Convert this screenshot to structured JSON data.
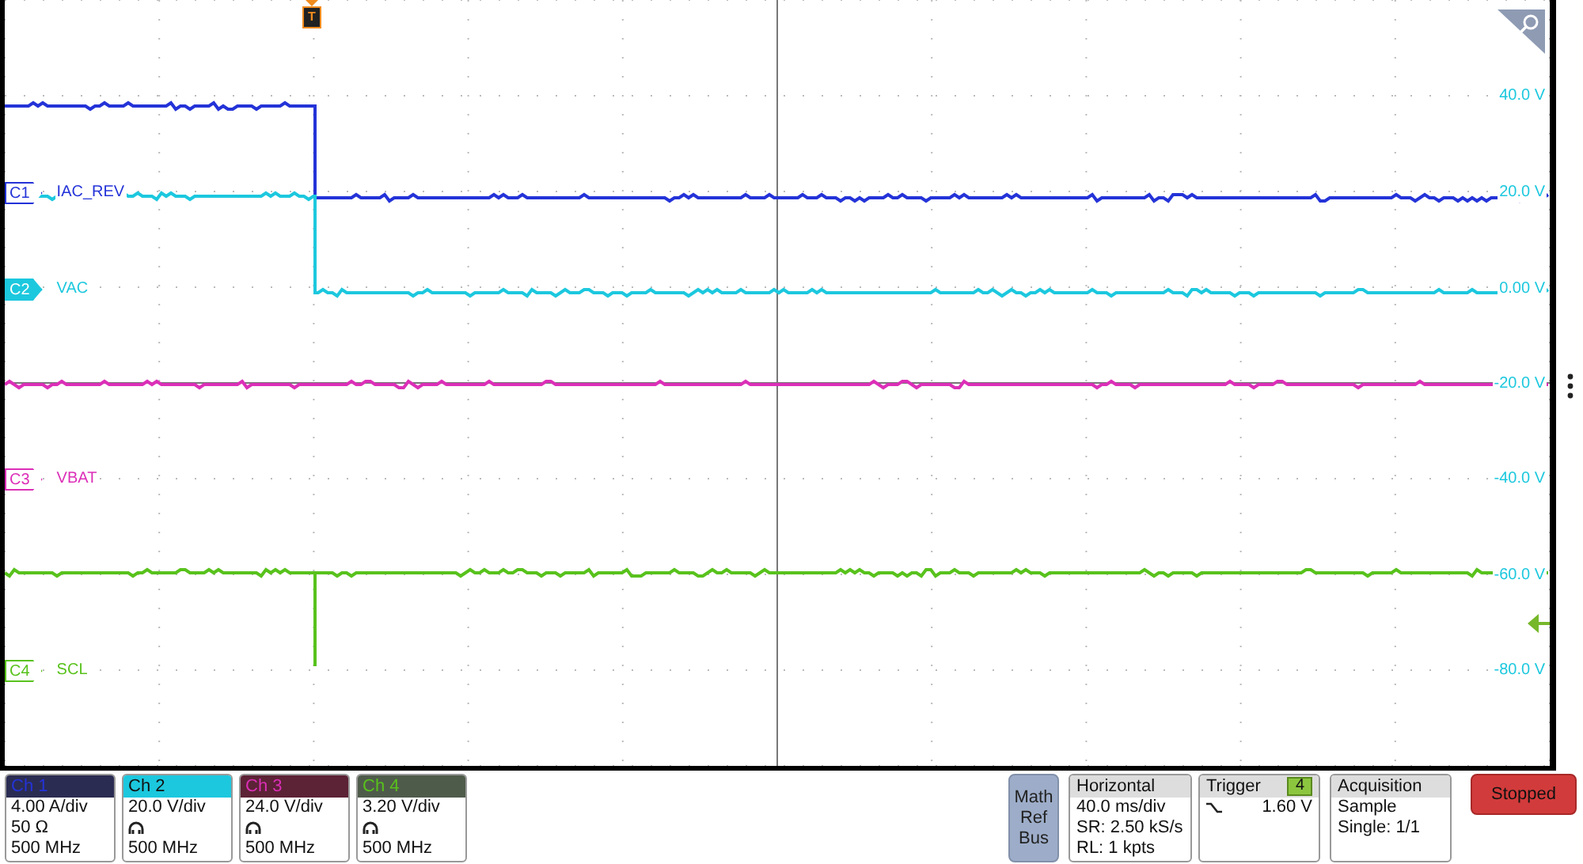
{
  "trigger_marker": {
    "label": "T"
  },
  "scale_labels": [
    "40.0 V",
    "20.0 V",
    "0.00 V",
    "-20.0 V",
    "-40.0 V",
    "-60.0 V",
    "-80.0 V"
  ],
  "channels": [
    {
      "id": "C1",
      "name": "IAC_REV",
      "color": "#2433d8",
      "selected": false
    },
    {
      "id": "C2",
      "name": "VAC",
      "color": "#1cc8de",
      "selected": true
    },
    {
      "id": "C3",
      "name": "VBAT",
      "color": "#dc2fb8",
      "selected": false
    },
    {
      "id": "C4",
      "name": "SCL",
      "color": "#58c21c",
      "selected": false
    }
  ],
  "channel_panels": [
    {
      "title": "Ch 1",
      "color": "#2b2c52",
      "selected": false,
      "scale": "4.00 A/div",
      "kind": "impedance",
      "impedance": "50 Ω",
      "bandwidth": "500 MHz"
    },
    {
      "title": "Ch 2",
      "color": "#1cc8de",
      "selected": true,
      "scale": "20.0 V/div",
      "kind": "probe",
      "bandwidth": "500 MHz"
    },
    {
      "title": "Ch 3",
      "color": "#5c2236",
      "selected": false,
      "scale": "24.0 V/div",
      "kind": "probe",
      "bandwidth": "500 MHz"
    },
    {
      "title": "Ch 4",
      "color": "#4f5b4a",
      "selected": false,
      "scale": "3.20 V/div",
      "kind": "probe",
      "bandwidth": "500 MHz"
    }
  ],
  "math_ref_bus": [
    "Math",
    "Ref",
    "Bus"
  ],
  "horizontal": {
    "title": "Horizontal",
    "lines": [
      "40.0 ms/div",
      "SR: 2.50 kS/s",
      "RL: 1 kpts"
    ]
  },
  "trigger": {
    "title": "Trigger",
    "source": "4",
    "level": "1.60 V"
  },
  "acquisition": {
    "title": "Acquisition",
    "lines": [
      "Sample",
      "Single: 1/1"
    ]
  },
  "run_state": "Stopped"
}
